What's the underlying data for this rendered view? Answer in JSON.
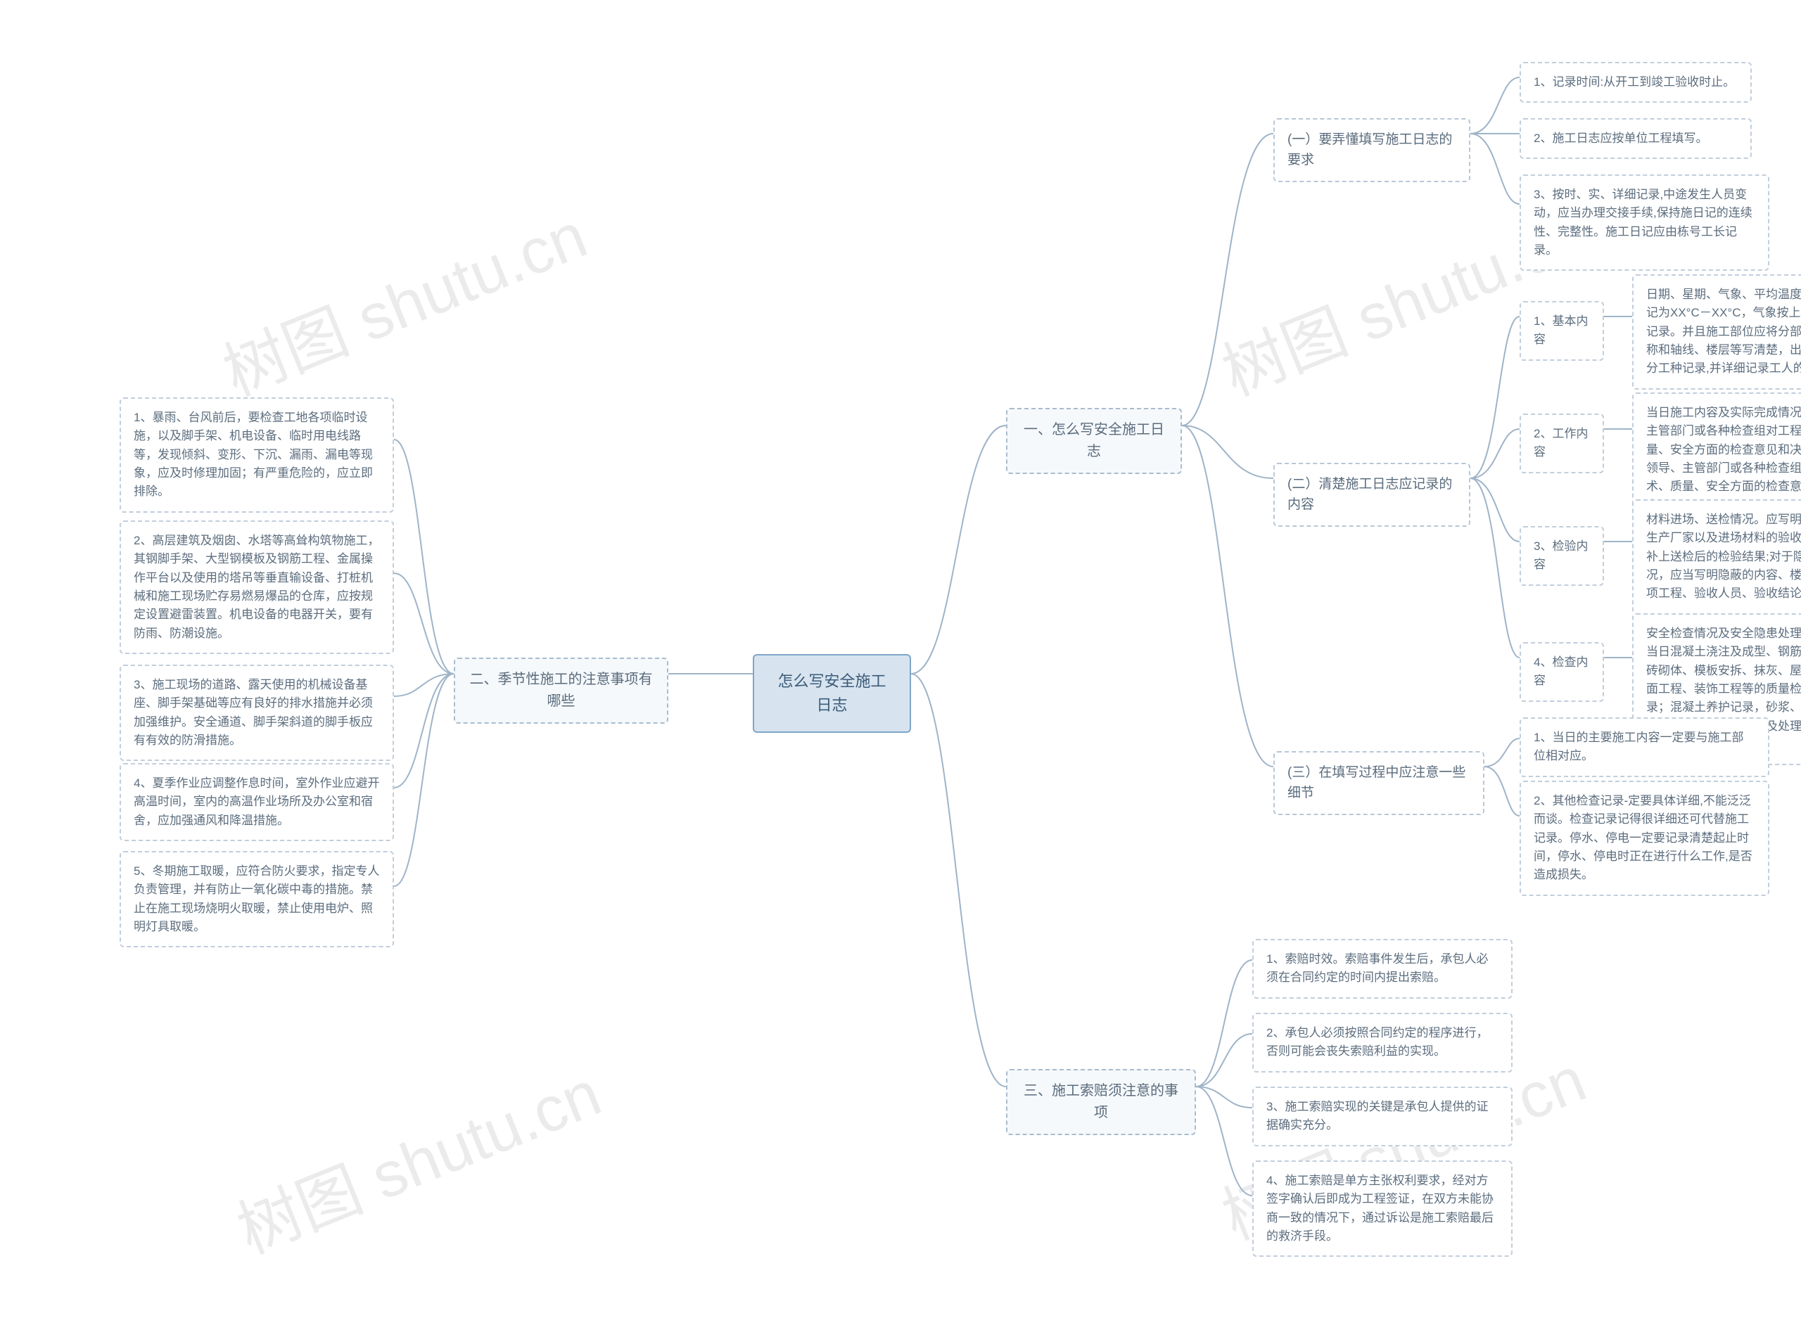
{
  "watermarks": [
    "树图 shutu.cn",
    "树图 shutu.cn",
    "树图 shutu.cn",
    "树图 shutu.cn"
  ],
  "root": {
    "label": "怎么写安全施工日志"
  },
  "branch1": {
    "label": "一、怎么写安全施工日志",
    "sub1": {
      "label": "(一）要弄懂填写施工日志的要求",
      "items": [
        "1、记录时间:从开工到竣工验收时止。",
        "2、施工日志应按单位工程填写。",
        "3、按时、实、详细记录,中途发生人员变动，应当办理交接手续,保持施日记的连续性、完整性。施工日记应由栋号工长记录。"
      ]
    },
    "sub2": {
      "label": "(二）清楚施工日志应记录的内容",
      "items": [
        {
          "title": "1、基本内容",
          "detail": "日期、星期、气象、平均温度。平均温度可记为XX°C－XX°C，气象按上午和下午分别记录。并且施工部位应将分部、分项工程名称和轴线、楼层等写清楚，出勤人数一定要分工种记录,并详细记录工人的总人数。"
        },
        {
          "title": "2、工作内容",
          "detail": "当日施工内容及实际完成情况，有关领导、主管部门或各种检查组对工程施工技术、质量、安全方面的检查意见和决定，以及有关领导、主管部门或各种检查组对工程施工技术、质量、安全方面的检查意见和决定等内容。"
        },
        {
          "title": "3、检验内容",
          "detail": "材料进场、送检情况。应写明批号、数量、生产厂家以及进场材料的验收情况。并且要补上送检后的检验结果;对于隐蔽工程验收情况，应当写明隐蔽的内容、楼层、轴线、分项工程、验收人员、验收结论等详细内容。"
        },
        {
          "title": "4、检查内容",
          "detail": "安全检查情况及安全隐患处理(纠正)情况，当日混凝土浇注及成型、钢筋安装及焊接、砖砌体、模板安拆、抹灰、屋面工程、楼地面工程、装饰工程等的质量检查和处理记录；混凝土养护记录，砂浆、混凝土外加剂掺用量；质量事故原因及处理方法，质量事故处理后的效果验证。"
        }
      ]
    },
    "sub3": {
      "label": "(三）在填写过程中应注意一些细节",
      "items": [
        "1、当日的主要施工内容一定要与施工部位相对应。",
        "2、其他检查记录-定要具体详细,不能泛泛而谈。检查记录记得很详细还可代替施工记录。停水、停电一定要记录清楚起止时间，停水、停电时正在进行什么工作,是否造成损失。"
      ]
    }
  },
  "branch2": {
    "label": "二、季节性施工的注意事项有哪些",
    "items": [
      "1、暴雨、台风前后，要检查工地各项临时设施，以及脚手架、机电设备、临时用电线路等，发现倾斜、变形、下沉、漏雨、漏电等现象，应及时修理加固；有严重危险的，应立即排除。",
      "2、高层建筑及烟囱、水塔等高耸构筑物施工，其钢脚手架、大型钢模板及钢筋工程、金属操作平台以及使用的塔吊等垂直输设备、打桩机械和施工现场贮存易燃易爆品的仓库，应按规定设置避雷装置。机电设备的电器开关，要有防雨、防潮设施。",
      "3、施工现场的道路、露天使用的机械设备基座、脚手架基础等应有良好的排水措施并必须加强维护。安全通道、脚手架斜道的脚手板应有有效的防滑措施。",
      "4、夏季作业应调整作息时间，室外作业应避开高温时间，室内的高温作业场所及办公室和宿舍，应加强通风和降温措施。",
      "5、冬期施工取暖，应符合防火要求，指定专人负责管理，并有防止一氧化碳中毒的措施。禁止在施工现场烧明火取暖，禁止使用电炉、照明灯具取暖。"
    ]
  },
  "branch3": {
    "label": "三、施工索赔须注意的事项",
    "items": [
      "1、索赔时效。索赔事件发生后，承包人必须在合同约定的时间内提出索赔。",
      "2、承包人必须按照合同约定的程序进行，否则可能会丧失索赔利益的实现。",
      "3、施工索赔实现的关键是承包人提供的证据确实充分。",
      "4、施工索赔是单方主张权利要求，经对方签字确认后即成为工程签证，在双方未能协商一致的情况下，通过诉讼是施工索赔最后的救济手段。"
    ]
  },
  "chart_data": {
    "type": "tree",
    "title": "怎么写安全施工日志",
    "children": [
      {
        "label": "一、怎么写安全施工日志",
        "children": [
          {
            "label": "(一）要弄懂填写施工日志的要求",
            "children": [
              {
                "label": "1、记录时间:从开工到竣工验收时止。"
              },
              {
                "label": "2、施工日志应按单位工程填写。"
              },
              {
                "label": "3、按时、实、详细记录,中途发生人员变动，应当办理交接手续,保持施日记的连续性、完整性。施工日记应由栋号工长记录。"
              }
            ]
          },
          {
            "label": "(二）清楚施工日志应记录的内容",
            "children": [
              {
                "label": "1、基本内容",
                "children": [
                  {
                    "label": "日期、星期、气象、平均温度。平均温度可记为XX°C－XX°C，气象按上午和下午分别记录。并且施工部位应将分部、分项工程名称和轴线、楼层等写清楚，出勤人数一定要分工种记录,并详细记录工人的总人数。"
                  }
                ]
              },
              {
                "label": "2、工作内容",
                "children": [
                  {
                    "label": "当日施工内容及实际完成情况，有关领导、主管部门或各种检查组对工程施工技术、质量、安全方面的检查意见和决定，以及有关领导、主管部门或各种检查组对工程施工技术、质量、安全方面的检查意见和决定等内容。"
                  }
                ]
              },
              {
                "label": "3、检验内容",
                "children": [
                  {
                    "label": "材料进场、送检情况。应写明批号、数量、生产厂家以及进场材料的验收情况。并且要补上送检后的检验结果;对于隐蔽工程验收情况，应当写明隐蔽的内容、楼层、轴线、分项工程、验收人员、验收结论等详细内容。"
                  }
                ]
              },
              {
                "label": "4、检查内容",
                "children": [
                  {
                    "label": "安全检查情况及安全隐患处理(纠正)情况，当日混凝土浇注及成型、钢筋安装及焊接、砖砌体、模板安拆、抹灰、屋面工程、楼地面工程、装饰工程等的质量检查和处理记录；混凝土养护记录，砂浆、混凝土外加剂掺用量；质量事故原因及处理方法，质量事故处理后的效果验证。"
                  }
                ]
              }
            ]
          },
          {
            "label": "(三）在填写过程中应注意一些细节",
            "children": [
              {
                "label": "1、当日的主要施工内容一定要与施工部位相对应。"
              },
              {
                "label": "2、其他检查记录-定要具体详细,不能泛泛而谈。检查记录记得很详细还可代替施工记录。停水、停电一定要记录清楚起止时间，停水、停电时正在进行什么工作,是否造成损失。"
              }
            ]
          }
        ]
      },
      {
        "label": "二、季节性施工的注意事项有哪些",
        "children": [
          {
            "label": "1、暴雨、台风前后，要检查工地各项临时设施，以及脚手架、机电设备、临时用电线路等，发现倾斜、变形、下沉、漏雨、漏电等现象，应及时修理加固；有严重危险的，应立即排除。"
          },
          {
            "label": "2、高层建筑及烟囱、水塔等高耸构筑物施工，其钢脚手架、大型钢模板及钢筋工程、金属操作平台以及使用的塔吊等垂直输设备、打桩机械和施工现场贮存易燃易爆品的仓库，应按规定设置避雷装置。机电设备的电器开关，要有防雨、防潮设施。"
          },
          {
            "label": "3、施工现场的道路、露天使用的机械设备基座、脚手架基础等应有良好的排水措施并必须加强维护。安全通道、脚手架斜道的脚手板应有有效的防滑措施。"
          },
          {
            "label": "4、夏季作业应调整作息时间，室外作业应避开高温时间，室内的高温作业场所及办公室和宿舍，应加强通风和降温措施。"
          },
          {
            "label": "5、冬期施工取暖，应符合防火要求，指定专人负责管理，并有防止一氧化碳中毒的措施。禁止在施工现场烧明火取暖，禁止使用电炉、照明灯具取暖。"
          }
        ]
      },
      {
        "label": "三、施工索赔须注意的事项",
        "children": [
          {
            "label": "1、索赔时效。索赔事件发生后，承包人必须在合同约定的时间内提出索赔。"
          },
          {
            "label": "2、承包人必须按照合同约定的程序进行，否则可能会丧失索赔利益的实现。"
          },
          {
            "label": "3、施工索赔实现的关键是承包人提供的证据确实充分。"
          },
          {
            "label": "4、施工索赔是单方主张权利要求，经对方签字确认后即成为工程签证，在双方未能协商一致的情况下，通过诉讼是施工索赔最后的救济手段。"
          }
        ]
      }
    ]
  }
}
